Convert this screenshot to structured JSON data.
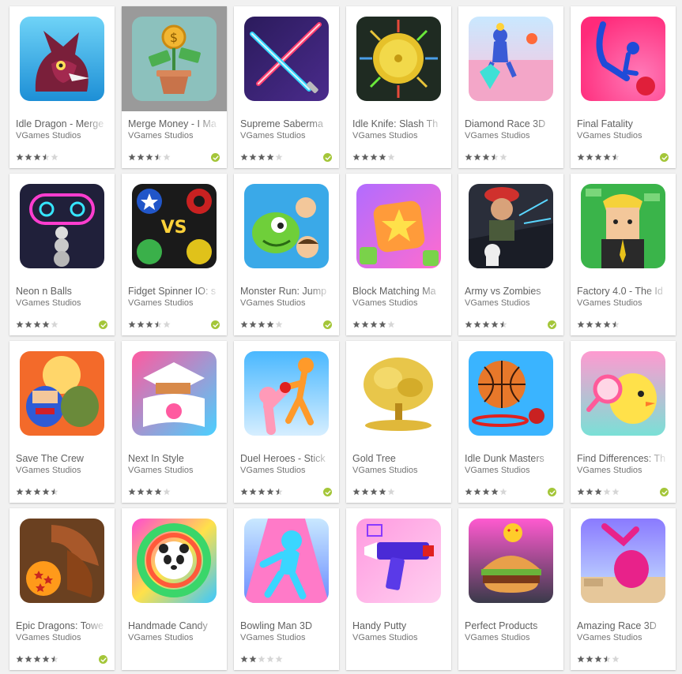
{
  "colors": {
    "page_bg": "#f1f1f1",
    "card_bg": "#ffffff",
    "title_text": "#616161",
    "developer_text": "#757575",
    "star_filled": "#616161",
    "star_empty": "#d6d6d6",
    "editors_badge": "#a4c639"
  },
  "apps": [
    {
      "title": "Idle Dragon - Merge",
      "developer": "VGames Studios",
      "rating": 3.5,
      "badge": false,
      "icon": "dragon-icon",
      "hover": false
    },
    {
      "title": "Merge Money - I Ma",
      "developer": "VGames Studios",
      "rating": 3.5,
      "badge": true,
      "icon": "money-plant-icon",
      "hover": true
    },
    {
      "title": "Supreme Saberma",
      "developer": "VGames Studios",
      "rating": 4,
      "badge": true,
      "icon": "light-saber-icon",
      "hover": false
    },
    {
      "title": "Idle Knife: Slash Th",
      "developer": "VGames Studios",
      "rating": 4,
      "badge": false,
      "icon": "knife-target-icon",
      "hover": false
    },
    {
      "title": "Diamond Race 3D",
      "developer": "VGames Studios",
      "rating": 3.5,
      "badge": false,
      "icon": "diamond-runner-icon",
      "hover": false
    },
    {
      "title": "Final Fatality",
      "developer": "VGames Studios",
      "rating": 4.5,
      "badge": true,
      "icon": "stickman-fight-icon",
      "hover": false
    },
    {
      "title": "Neon n Balls",
      "developer": "VGames Studios",
      "rating": 4,
      "badge": true,
      "icon": "neon-balls-icon",
      "hover": false
    },
    {
      "title": "Fidget Spinner IO: s",
      "developer": "VGames Studios",
      "rating": 3.5,
      "badge": true,
      "icon": "fidget-spinner-icon",
      "hover": false
    },
    {
      "title": "Monster Run: Jump",
      "developer": "VGames Studios",
      "rating": 4,
      "badge": true,
      "icon": "monster-icon",
      "hover": false
    },
    {
      "title": "Block Matching Ma",
      "developer": "VGames Studios",
      "rating": 4,
      "badge": false,
      "icon": "star-block-icon",
      "hover": false
    },
    {
      "title": "Army vs Zombies",
      "developer": "VGames Studios",
      "rating": 4.5,
      "badge": true,
      "icon": "soldier-zombie-icon",
      "hover": false
    },
    {
      "title": "Factory 4.0 - The Id",
      "developer": "VGames Studios",
      "rating": 4.5,
      "badge": false,
      "icon": "businessman-icon",
      "hover": false
    },
    {
      "title": "Save The Crew",
      "developer": "VGames Studios",
      "rating": 4.5,
      "badge": false,
      "icon": "heroes-icon",
      "hover": false
    },
    {
      "title": "Next In Style",
      "developer": "VGames Studios",
      "rating": 4,
      "badge": false,
      "icon": "sushi-slide-icon",
      "hover": false
    },
    {
      "title": "Duel Heroes - Stick",
      "developer": "VGames Studios",
      "rating": 4.5,
      "badge": true,
      "icon": "boxing-duel-icon",
      "hover": false
    },
    {
      "title": "Gold Tree",
      "developer": "VGames Studios",
      "rating": 4,
      "badge": false,
      "icon": "gold-tree-icon",
      "hover": false
    },
    {
      "title": "Idle Dunk Masters",
      "developer": "VGames Studios",
      "rating": 4,
      "badge": true,
      "icon": "basketball-icon",
      "hover": false
    },
    {
      "title": "Find Differences: Th",
      "developer": "VGames Studios",
      "rating": 3,
      "badge": true,
      "icon": "magnifier-chick-icon",
      "hover": false
    },
    {
      "title": "Epic Dragons: Towe",
      "developer": "VGames Studios",
      "rating": 4.5,
      "badge": true,
      "icon": "dragon-ball-icon",
      "hover": false
    },
    {
      "title": "Handmade Candy",
      "developer": "VGames Studios",
      "rating": 0,
      "badge": false,
      "icon": "panda-candy-icon",
      "hover": false
    },
    {
      "title": "Bowling Man 3D",
      "developer": "VGames Studios",
      "rating": 2,
      "badge": false,
      "icon": "bowling-man-icon",
      "hover": false
    },
    {
      "title": "Handy Putty",
      "developer": "VGames Studios",
      "rating": 0,
      "badge": false,
      "icon": "putty-gun-icon",
      "hover": false
    },
    {
      "title": "Perfect Products",
      "developer": "VGames Studios",
      "rating": 0,
      "badge": false,
      "icon": "burger-icon",
      "hover": false
    },
    {
      "title": "Amazing Race 3D",
      "developer": "VGames Studios",
      "rating": 3.5,
      "badge": false,
      "icon": "flip-runner-icon",
      "hover": false
    }
  ]
}
